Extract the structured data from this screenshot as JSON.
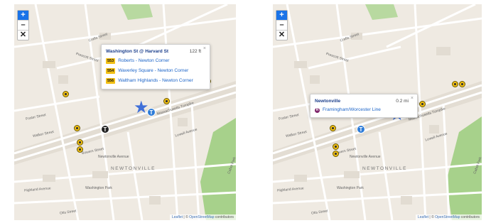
{
  "zoom": {
    "plus": "+",
    "minus": "–",
    "reset": "✕"
  },
  "attribution": {
    "prefix": "Leaflet",
    "sep": " | © ",
    "osm": "OpenStreetMap",
    "suffix": " contributors"
  },
  "left": {
    "popup": {
      "stop_name": "Washington St @ Harvard St",
      "distance": "122 ft",
      "close": "×",
      "routes": [
        {
          "badge": "553",
          "name": "Roberts - Newton Corner"
        },
        {
          "badge": "554",
          "name": "Waverley Square - Newton Corner"
        },
        {
          "badge": "556",
          "name": "Waltham Highlands - Newton Corner"
        }
      ]
    },
    "street_labels": [
      "Crafts Street",
      "Prescott Street",
      "Foster Street",
      "Walker Street",
      "Bowers Street",
      "Newtonville Avenue",
      "NEWTONVILLE",
      "Highland Avenue",
      "Washington Park",
      "Otis Street",
      "Massachusetts Turnpike",
      "Lowell Avenue",
      "Cabot Park"
    ]
  },
  "right": {
    "popup": {
      "stop_name": "Newtonville",
      "distance": "0.2 mi",
      "close": "×",
      "line_icon": "R",
      "line_name": "Framingham/Worcester Line"
    },
    "street_labels": [
      "Crafts Street",
      "Prescott Street",
      "Foster Street",
      "Walker Street",
      "Bowers Street",
      "Newtonville Avenue",
      "NEWTONVILLE",
      "Highland Avenue",
      "Washington Park",
      "Otis Street",
      "Massachusetts Turnpike",
      "Lowell Avenue",
      "Cabot Park"
    ]
  },
  "icons": {
    "bus_stop": "bus-stop-icon",
    "subway": "T",
    "station": "T",
    "user_location": "★"
  },
  "colors": {
    "accent": "#1a73e8",
    "bus_badge": "#f2c014",
    "rail": "#80276c",
    "star": "#3f6fd8",
    "park": "#a7d18b"
  }
}
